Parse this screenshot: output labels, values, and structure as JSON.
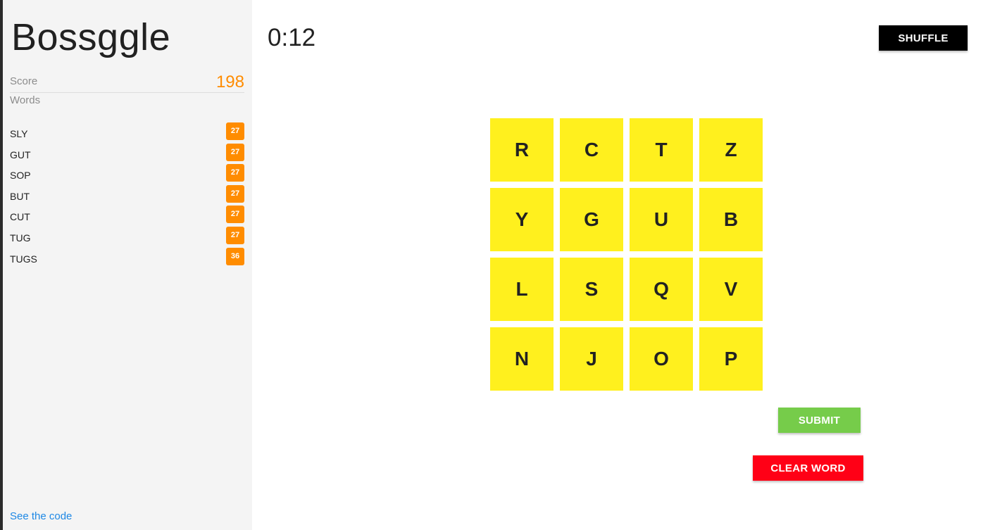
{
  "app_title": "Bossggle",
  "score": {
    "label": "Score",
    "value": "198"
  },
  "words_label": "Words",
  "words": [
    {
      "word": "SLY",
      "points": "27"
    },
    {
      "word": "GUT",
      "points": "27"
    },
    {
      "word": "SOP",
      "points": "27"
    },
    {
      "word": "BUT",
      "points": "27"
    },
    {
      "word": "CUT",
      "points": "27"
    },
    {
      "word": "TUG",
      "points": "27"
    },
    {
      "word": "TUGS",
      "points": "36"
    }
  ],
  "code_link": "See the code",
  "timer": "0:12",
  "buttons": {
    "shuffle": "SHUFFLE",
    "submit": "SUBMIT",
    "clear": "CLEAR WORD"
  },
  "board": [
    [
      "R",
      "C",
      "T",
      "Z"
    ],
    [
      "Y",
      "G",
      "U",
      "B"
    ],
    [
      "L",
      "S",
      "Q",
      "V"
    ],
    [
      "N",
      "J",
      "O",
      "P"
    ]
  ],
  "colors": {
    "accent": "#ff8c00",
    "tile": "#fff01e",
    "submit": "#76cc4a",
    "clear": "#ff0016",
    "shuffle": "#000000",
    "link": "#1e88e5"
  }
}
